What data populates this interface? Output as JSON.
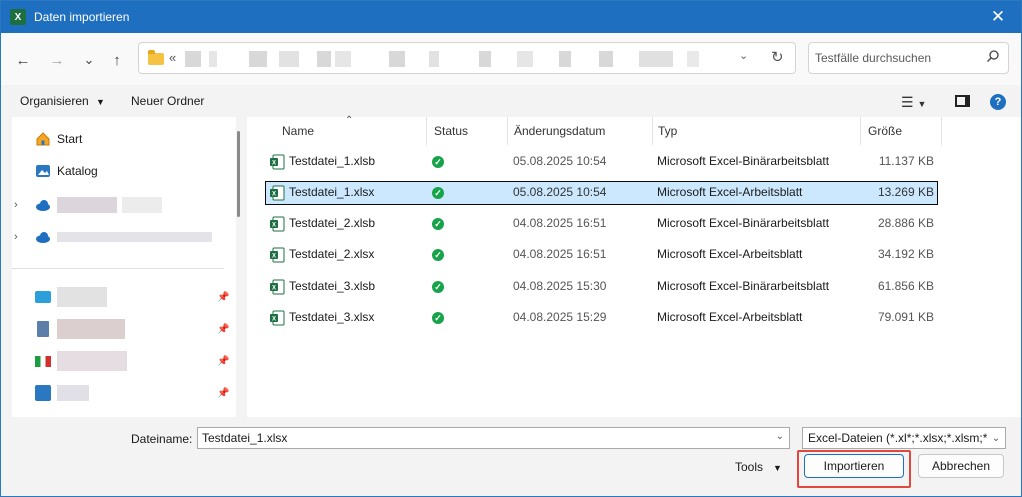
{
  "window": {
    "title": "Daten importieren",
    "app_icon": "X",
    "close_label": "✕"
  },
  "nav": {
    "back": "←",
    "forward": "→",
    "recent": "⌄",
    "up": "↑",
    "address_prefix": "«",
    "search_placeholder": "Testfälle durchsuchen"
  },
  "toolbar": {
    "organize": "Organisieren",
    "new_folder": "Neuer Ordner"
  },
  "sidebar": {
    "items": [
      {
        "label": "Start",
        "icon": "home-icon"
      },
      {
        "label": "Katalog",
        "icon": "gallery-icon"
      }
    ]
  },
  "columns": {
    "name": "Name",
    "status": "Status",
    "date": "Änderungsdatum",
    "type": "Typ",
    "size": "Größe"
  },
  "files": [
    {
      "name": "Testdatei_1.xlsb",
      "date": "05.08.2025 10:54",
      "type": "Microsoft Excel-Binärarbeitsblatt",
      "size": "11.137 KB",
      "selected": false
    },
    {
      "name": "Testdatei_1.xlsx",
      "date": "05.08.2025 10:54",
      "type": "Microsoft Excel-Arbeitsblatt",
      "size": "13.269 KB",
      "selected": true
    },
    {
      "name": "Testdatei_2.xlsb",
      "date": "04.08.2025 16:51",
      "type": "Microsoft Excel-Binärarbeitsblatt",
      "size": "28.886 KB",
      "selected": false
    },
    {
      "name": "Testdatei_2.xlsx",
      "date": "04.08.2025 16:51",
      "type": "Microsoft Excel-Arbeitsblatt",
      "size": "34.192 KB",
      "selected": false
    },
    {
      "name": "Testdatei_3.xlsb",
      "date": "04.08.2025 15:30",
      "type": "Microsoft Excel-Binärarbeitsblatt",
      "size": "61.856 KB",
      "selected": false
    },
    {
      "name": "Testdatei_3.xlsx",
      "date": "04.08.2025 15:29",
      "type": "Microsoft Excel-Arbeitsblatt",
      "size": "79.091 KB",
      "selected": false
    }
  ],
  "bottom": {
    "filename_label": "Dateiname:",
    "filename_value": "Testdatei_1.xlsx",
    "filter_value": "Excel-Dateien (*.xl*;*.xlsx;*.xlsm;*.x",
    "tools": "Tools",
    "import": "Importieren",
    "cancel": "Abbrechen"
  },
  "colors": {
    "accent": "#1f6fc0",
    "selection": "#cce8ff",
    "highlight": "#e0473d",
    "excel": "#1d6f42",
    "status_ok": "#16a34a"
  }
}
